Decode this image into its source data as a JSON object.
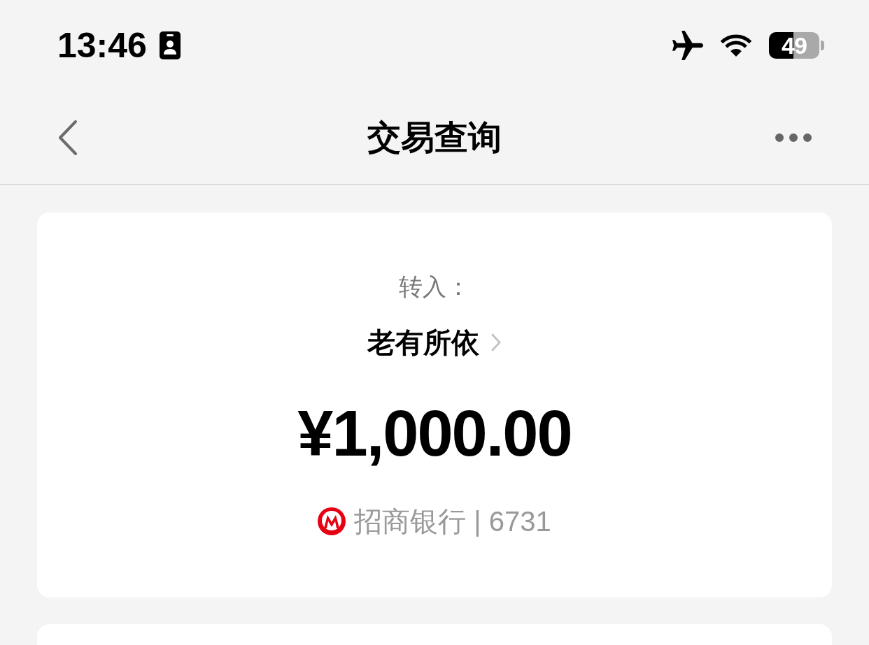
{
  "status_bar": {
    "time": "13:46",
    "battery": "49"
  },
  "nav_bar": {
    "title": "交易查询"
  },
  "transaction": {
    "direction_label": "转入：",
    "counterparty": "老有所依",
    "amount": "¥1,000.00",
    "bank_account": "招商银行 | 6731"
  }
}
